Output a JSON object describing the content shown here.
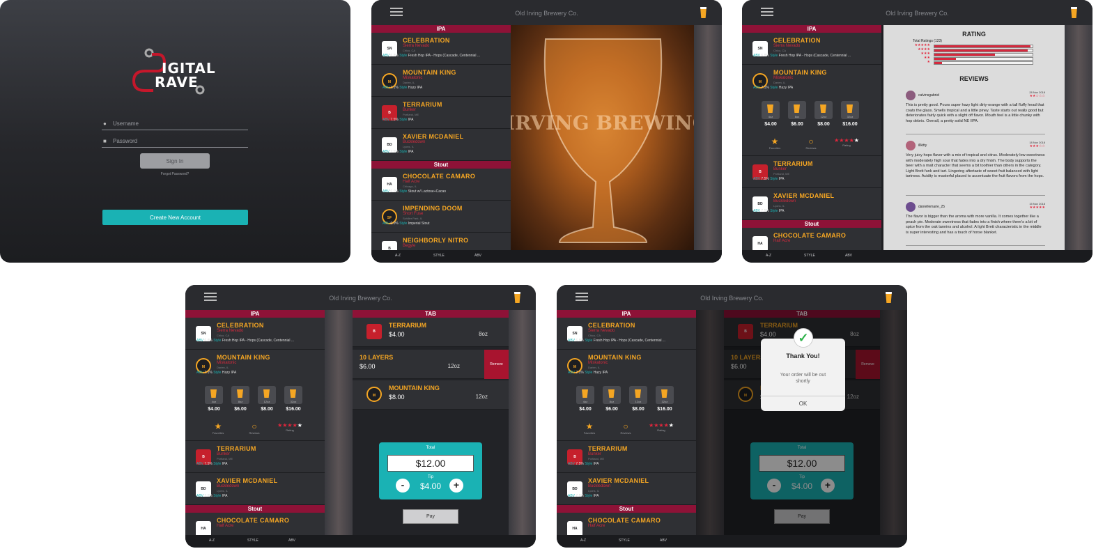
{
  "login": {
    "logo_line1": "IGITAL",
    "logo_line2": "RAVE",
    "username_placeholder": "Username",
    "password_placeholder": "Password",
    "signin": "Sign In",
    "forgot": "Forgot Password?",
    "create": "Create New Account"
  },
  "app": {
    "title": "Old Irving Brewery Co.",
    "sort_tabs": [
      "A-Z",
      "STYLE",
      "ABV"
    ],
    "section_ipa": "IPA",
    "section_stout": "Stout",
    "section_tab": "TAB",
    "abv_label": "ABV",
    "style_label": "Style",
    "brewery_photo_text": "OLD IRVING BREWING CO."
  },
  "beers": [
    {
      "name": "CELEBRATION",
      "brewery": "Sierra Nevado",
      "location": "Chico, CA",
      "abv": "6.8%",
      "style": "Fresh Hop IPA - Hops (Cascade, Centennial ..."
    },
    {
      "name": "MOUNTAIN KING",
      "brewery": "Miskatonic",
      "location": "Darien, IL",
      "abv": "7.1%",
      "style": "Hazy IPA"
    },
    {
      "name": "TERRARIUM",
      "brewery": "Bunker",
      "location": "Portland, ME",
      "abv": "7.5%",
      "style": "IPA"
    },
    {
      "name": "XAVIER MCDANIEL",
      "brewery": "Buckledown",
      "location": "Lyons, IL",
      "abv": "7.5%",
      "style": "IPA"
    },
    {
      "name": "CHOCOLATE CAMARO",
      "brewery": "Half Acre",
      "location": "Chicago, IL",
      "abv": "6.0%",
      "style": "Stout w/ Lactose+Cacao"
    },
    {
      "name": "IMPENDING DOOM",
      "brewery": "Short Fuse",
      "location": "Schiller Park, IL",
      "abv": "6.0%",
      "style": "Imperial Stout"
    },
    {
      "name": "NEIGHBORLY NITRO",
      "brewery": "Begyle",
      "location": "",
      "abv": "",
      "style": ""
    }
  ],
  "sizes": [
    {
      "label": "4oz",
      "price": "$4.00"
    },
    {
      "label": "8oz",
      "price": "$6.00"
    },
    {
      "label": "12oz",
      "price": "$8.00"
    },
    {
      "label": "32oz",
      "price": "$16.00"
    }
  ],
  "actions": {
    "favorites": "Favorites",
    "reviews": "Reviews",
    "rating": "Rating",
    "rating_stars": "★★★★",
    "rating_empty": "★"
  },
  "rating_panel": {
    "title": "RATING",
    "total": "Total Ratings (123)",
    "distribution": [
      0.98,
      0.95,
      0.62,
      0.22,
      0.08
    ],
    "star_rows": [
      "★★★★★",
      "★★★★",
      "★★★",
      "★★",
      "★"
    ],
    "reviews_title": "REVIEWS",
    "reviews": [
      {
        "user": "calvinsgabriel",
        "date": "28 Nov 2018",
        "stars": "★★☆☆☆",
        "text": "This is pretty good. Pours super hazy light dirty-orange with a tall fluffy head that coats the glass. Smells tropical and a little piney. Taste starts out really good but deteriorates fairly quick with a slight off flavor. Mouth feel is a little chunky with hop debris. Overall, a pretty solid NE IIPA."
      },
      {
        "user": "illkitty",
        "date": "18 Nov 2018",
        "stars": "★★★☆☆",
        "text": "Very juicy hops flavor with a mix of tropical and citrus. Moderately low sweetness with moderately high sour that fades into a dry finish. The body supports the beer with a malt character that seems a bit toothier than others in the category. Light Brett funk and tart. Lingering aftertaste of sweet fruit balanced with light tartness. Acidity is masterful placed to accentuate the fruit flavors from the hops."
      },
      {
        "user": "daniellemarie_25",
        "date": "15 Nov 2018",
        "stars": "★★★★★",
        "text": "The flavor is bigger than the aroma with more vanilla. It comes together like a peach pie. Moderate sweetness that fades into a finish where there's a bit of spice from the oak tannins and alcohol. A light Brett characteristic in the middle is super interesting and has a touch of horse blanket."
      }
    ]
  },
  "tab": {
    "items": [
      {
        "name": "TERRARIUM",
        "price": "$4.00",
        "size": "8oz"
      },
      {
        "name": "10 LAYERS",
        "price": "$6.00",
        "size": "12oz",
        "action": "Remove"
      },
      {
        "name": "MOUNTAIN KING",
        "price": "$8.00",
        "size": "12oz"
      }
    ],
    "total_label": "Total",
    "total": "$12.00",
    "tip_label": "Tip",
    "tip": "$4.00",
    "minus": "-",
    "plus": "+",
    "pay": "Pay"
  },
  "modal": {
    "title": "Thank You!",
    "message": "Your order will be out shortly",
    "ok": "OK"
  },
  "colors": {
    "accent": "#f5a623",
    "teal": "#1ab2b4",
    "section": "#8e1237",
    "red": "#d32a3d"
  }
}
